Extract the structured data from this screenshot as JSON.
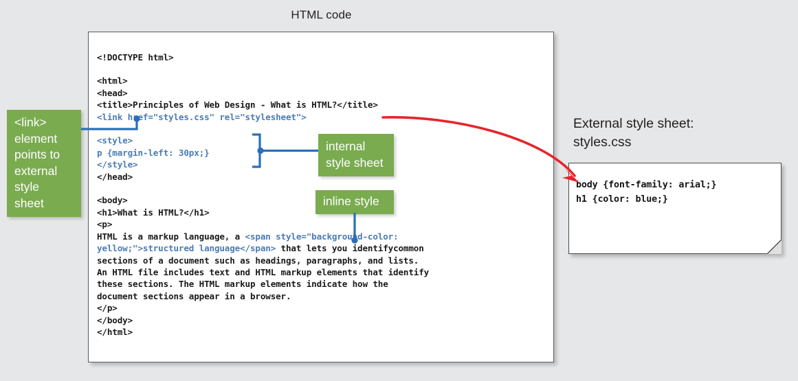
{
  "title": "HTML code",
  "colors": {
    "background": "#e6e7e8",
    "callout_green": "#7aab4f",
    "code_blue": "#4a7cb5",
    "code_black": "#1a1a1a",
    "connector_blue": "#2a6ebb",
    "arrow_red": "#e8232a",
    "box_border": "#5a5a5a"
  },
  "code_box": {
    "lines": [
      {
        "text": "<!DOCTYPE html>",
        "color": "black"
      },
      {
        "text": "",
        "color": "black"
      },
      {
        "text": "<html>",
        "color": "black"
      },
      {
        "text": "<head>",
        "color": "black"
      },
      {
        "text": "<title>Principles of Web Design - What is HTML?</title>",
        "color": "black"
      },
      {
        "text": "<link href=\"styles.css\" rel=\"stylesheet\">",
        "color": "blue"
      },
      {
        "text": "",
        "color": "black"
      },
      {
        "text": "<style>",
        "color": "blue"
      },
      {
        "text": "p {margin-left: 30px;}",
        "color": "blue"
      },
      {
        "text": "</style>",
        "color": "blue"
      },
      {
        "text": "</head>",
        "color": "black"
      },
      {
        "text": "",
        "color": "black"
      },
      {
        "text": "<body>",
        "color": "black"
      },
      {
        "text": "<h1>What is HTML?</h1>",
        "color": "black"
      },
      {
        "text": "<p>",
        "color": "black"
      }
    ],
    "paragraph_line_1_prefix": "HTML is a markup language, a ",
    "paragraph_span_open": "<span style=\"background-color:",
    "paragraph_span_continue": "yellow;\">structured language</span>",
    "paragraph_line_2_suffix": " that lets you identifycommon",
    "paragraph_rest": [
      "sections of a document such as headings, paragraphs, and lists.",
      "An HTML file includes text and HTML markup elements that identify",
      "these sections. The HTML markup elements indicate how the",
      "document sections appear in a browser."
    ],
    "closing_lines": [
      "</p>",
      "</body>",
      "</html>"
    ]
  },
  "callouts": {
    "link_element": "<link>\nelement\npoints to\nexternal\nstyle\nsheet",
    "internal_style_sheet": "internal\nstyle sheet",
    "inline_style": "inline style"
  },
  "external": {
    "heading": "External style sheet:\nstyles.css",
    "css_lines": [
      "body {font-family: arial;}",
      "h1 {color: blue;}"
    ]
  }
}
